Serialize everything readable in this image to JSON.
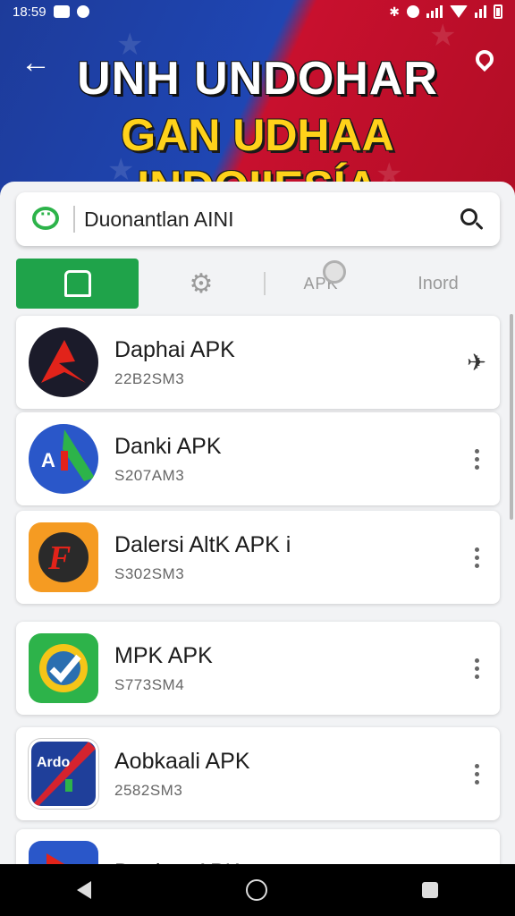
{
  "status_bar": {
    "time": "18:59"
  },
  "header": {
    "title_line1": "UNH UNDOHAR",
    "title_line2": "GAN UDHAA INDOIIESÍA"
  },
  "search": {
    "value": "Duonantlan AINI"
  },
  "tabs": [
    {
      "label": "",
      "icon": "bag-icon",
      "active": true
    },
    {
      "label": "",
      "icon": "gear-icon",
      "active": false
    },
    {
      "label": "APK",
      "icon": "disc-icon",
      "active": false
    },
    {
      "label": "Inord",
      "icon": "",
      "active": false
    }
  ],
  "apps": [
    {
      "name": "Daphai APK",
      "size": "22B2SM3",
      "action": "pin",
      "icon_colors": [
        "#1b1b2a",
        "#e2231a"
      ]
    },
    {
      "name": "Danki APK",
      "size": "S207AM3",
      "action": "more",
      "icon_colors": [
        "#2a57c9",
        "#2db34a"
      ]
    },
    {
      "name": "Dalersi AltK APK i",
      "size": "S302SM3",
      "action": "more",
      "icon_colors": [
        "#f59b22",
        "#2a2a2a"
      ]
    },
    {
      "name": "MPK APK",
      "size": "S773SM4",
      "action": "more",
      "icon_colors": [
        "#2db34a",
        "#f5c518"
      ]
    },
    {
      "name": "Aobkaali APK",
      "size": "2582SM3",
      "action": "more",
      "icon_colors": [
        "#1f3f9a",
        "#d5232e"
      ]
    },
    {
      "name": "Dunlos: APK",
      "size": "",
      "action": "more",
      "icon_colors": [
        "#2a57c9",
        "#e2231a"
      ]
    }
  ],
  "colors": {
    "accent_green": "#1fa34a",
    "banner_blue": "#1f46b3",
    "banner_red": "#c8102e",
    "title_yellow": "#ffd21a"
  }
}
